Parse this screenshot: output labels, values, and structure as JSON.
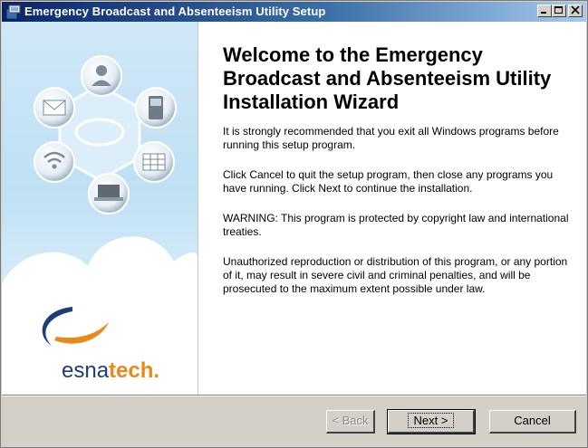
{
  "window": {
    "title": "Emergency Broadcast and Absenteeism Utility Setup",
    "controls": [
      "minimize",
      "maximize",
      "close"
    ]
  },
  "wizard": {
    "heading": "Welcome to the Emergency Broadcast and Absenteeism Utility Installation Wizard",
    "paragraphs": [
      "It is strongly recommended that you exit all Windows programs before running this setup program.",
      "Click Cancel to quit the setup program, then close any programs you have running.  Click Next to continue the installation.",
      "WARNING: This program is protected by copyright law and international treaties.",
      "Unauthorized reproduction or distribution of this program, or any portion of it, may result in severe civil and criminal penalties, and will be prosecuted to the maximum extent possible under law."
    ]
  },
  "brand": {
    "logo_text_a": "esna",
    "logo_text_b": "tech",
    "logo_dot": ".",
    "colors": {
      "navy": "#1f3d7a",
      "orange": "#e8891a"
    }
  },
  "buttons": {
    "back": "< Back",
    "next": "Next >",
    "cancel": "Cancel"
  },
  "icons": [
    "person-icon",
    "phone-icon",
    "calendar-icon",
    "laptop-icon",
    "wifi-icon",
    "mail-icon"
  ]
}
